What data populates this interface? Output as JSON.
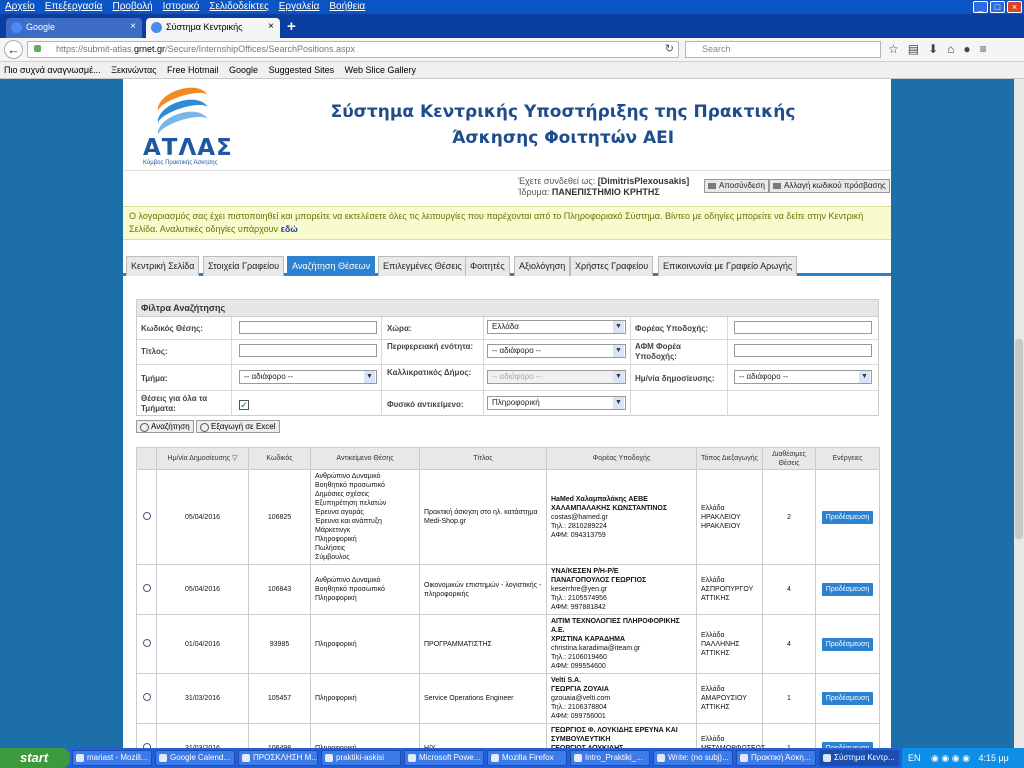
{
  "menu": [
    "Αρχείο",
    "Επεξεργασία",
    "Προβολή",
    "Ιστορικό",
    "Σελιδοδείκτες",
    "Εργαλεία",
    "Βοήθεια"
  ],
  "tabs": [
    {
      "label": "Google",
      "close": "×"
    },
    {
      "label": "Σύστημα Κεντρικής Υποστήριξ...",
      "close": "×"
    }
  ],
  "new_tab": "+",
  "url": {
    "prefix": "https://submit-atlas.",
    "domain": "grnet.gr",
    "path": "/Secure/InternshipOffices/SearchPositions.aspx"
  },
  "search_placeholder": "Search",
  "bookmarks": [
    "Πιο συχνά αναγνωσμέ...",
    "Ξεκινώντας",
    "Free Hotmail",
    "Google",
    "Suggested Sites",
    "Web Slice Gallery"
  ],
  "logo": {
    "text": "ΑΤΛΑΣ",
    "subtitle": "Κόμβος Πρακτικής Άσκησης"
  },
  "site_title": "Σύστημα Κεντρικής Υποστήριξης της Πρακτικής Άσκησης Φοιτητών ΑΕΙ",
  "user": {
    "connected_label": "Έχετε συνδεθεί ως:",
    "username": "[DimitrisPlexousakis]",
    "institution_label": "Ίδρυμα:",
    "institution": "ΠΑΝΕΠΙΣΤΗΜΙΟ ΚΡΗΤΗΣ",
    "logout": "Αποσύνδεση",
    "change_password": "Αλλαγή κωδικού πρόσβασης"
  },
  "notice": {
    "text": "Ο λογαριασμός σας έχει πιστοποιηθεί και μπορείτε να εκτελέσετε όλες τις λειτουργίες που παρέχονται από το Πληροφοριακό Σύστημα. Βίντεο με οδηγίες μπορείτε να δείτε στην Κεντρική Σελίδα. Αναλυτικές οδηγίες υπάρχουν",
    "link": "εδώ"
  },
  "page_tabs": [
    "Κεντρική Σελίδα",
    "Στοιχεία Γραφείου",
    "Αναζήτηση Θέσεων",
    "Επιλεγμένες Θέσεις",
    "Φοιτητές",
    "Αξιολόγηση",
    "Χρήστες Γραφείου",
    "Επικοινωνία με Γραφείο Αρωγής"
  ],
  "filters": {
    "title": "Φίλτρα Αναζήτησης",
    "code": "Κωδικός Θέσης:",
    "country": "Χώρα:",
    "country_value": "Ελλάδα",
    "host": "Φορέας Υποδοχής:",
    "title_label": "Τίτλος:",
    "region": "Περιφερειακή ενότητα:",
    "region_value": "-- αδιάφορο --",
    "host_afm": "ΑΦΜ Φορέα Υποδοχής:",
    "department": "Τμήμα:",
    "department_value": "-- αδιάφορο --",
    "municipality": "Καλλικρατικός Δήμος:",
    "municipality_value": "-- αδιάφορο --",
    "pub_date": "Ημ/νία δημοσίευσης:",
    "pub_date_value": "-- αδιάφορο --",
    "all_departments": "Θέσεις για όλα τα Τμήματα:",
    "all_departments_checked": "✓",
    "physical_object": "Φυσικό αντικείμενο:",
    "physical_object_value": "Πληροφορική"
  },
  "actions": {
    "search": "Αναζήτηση",
    "export": "Εξαγωγή σε Excel"
  },
  "table": {
    "headers": [
      "",
      "Ημ/νία Δημοσίευσης",
      "Κωδικός",
      "Αντικείμενο Θέσης",
      "Τίτλος",
      "Φορέας Υποδοχής",
      "Τόπος Διεξαγωγής",
      "Διαθέσιμες Θέσεις",
      "Ενέργειες"
    ],
    "sort_indicator": "▽",
    "rows": [
      {
        "date": "05/04/2016",
        "code": "106825",
        "objects": [
          "Ανθρώπινο Δυναμικό",
          "Βοηθητικό προσωπικό",
          "Δημόσιες σχέσεις",
          "Εξυπηρέτηση πελατών",
          "Έρευνα αγοράς",
          "Έρευνα και ανάπτυξη",
          "Μάρκετινγκ",
          "Πληροφορική",
          "Πωλήσεις",
          "Σύμβουλος"
        ],
        "title": "Πρακτική άσκηση στο ηλ. κατάστημα Medi-Shop.gr",
        "host": [
          "HaMed Χαλαμπαλάκης ΑΕΒΕ",
          "ΧΑΛΑΜΠΑΛΑΚΗΣ ΚΩΝΣΤΑΝΤΙΝΟΣ"
        ],
        "contact": [
          "costas@hamed.gr",
          "Τηλ.: 2810289224",
          "ΑΦΜ: 094313759"
        ],
        "place": [
          "Ελλάδα",
          "ΗΡΑΚΛΕΙΟΥ",
          "ΗΡΑΚΛΕΙΟΥ"
        ],
        "positions": "2",
        "action": "Προδέσμευση"
      },
      {
        "date": "05/04/2016",
        "code": "106843",
        "objects": [
          "Ανθρώπινο Δυναμικό",
          "Βοηθητικό προσωπικό",
          "Πληροφορική"
        ],
        "title": "Οικονομικών επιστημών - λογιστικής - πληροφορικής",
        "host": [
          "ΥΝΑ/ΚΕΣΕΝ Ρ/Η-Ρ/Ε",
          "ΠΑΝΑΓΟΠΟΥΛΟΣ ΓΕΩΡΓΙΟΣ"
        ],
        "contact": [
          "keserrhre@yen.gr",
          "Τηλ.: 2105574956",
          "ΑΦΜ: 997881842"
        ],
        "place": [
          "Ελλάδα",
          "ΑΣΠΡΟΠΥΡΓΟΥ",
          "ΑΤΤΙΚΗΣ"
        ],
        "positions": "4",
        "action": "Προδέσμευση"
      },
      {
        "date": "01/04/2016",
        "code": "93985",
        "objects": [
          "Πληροφορική"
        ],
        "title": "ΠΡΟΓΡΑΜΜΑΤΙΣΤΗΣ",
        "host": [
          "ΑΙΤΙΜ ΤΕΧΝΟΛΟΓΙΕΣ ΠΛΗΡΟΦΟΡΙΚΗΣ Α.Ε.",
          "ΧΡΙΣΤΙΝΑ ΚΑΡΑΔΗΜΑ"
        ],
        "contact": [
          "christina.karadima@iteam.gr",
          "Τηλ.: 2106019460",
          "ΑΦΜ: 099554600"
        ],
        "place": [
          "Ελλάδα",
          "ΠΑΛΛΗΝΗΣ",
          "ΑΤΤΙΚΗΣ"
        ],
        "positions": "4",
        "action": "Προδέσμευση"
      },
      {
        "date": "31/03/2016",
        "code": "105457",
        "objects": [
          "Πληροφορική"
        ],
        "title": "Service Operations Engineer",
        "host": [
          "Velti S.A.",
          "ΓΕΩΡΓΙΑ ΖΟΥΑΙΑ"
        ],
        "contact": [
          "gzouaia@velti.com",
          "Τηλ.: 2106378804",
          "ΑΦΜ: 099756001"
        ],
        "place": [
          "Ελλάδα",
          "ΑΜΑΡΟΥΣΙΟΥ",
          "ΑΤΤΙΚΗΣ"
        ],
        "positions": "1",
        "action": "Προδέσμευση"
      },
      {
        "date": "31/03/2016",
        "code": "106498",
        "objects": [
          "Πληροφορική"
        ],
        "title": "Η/Υ",
        "host": [
          "ΓΕΩΡΓΙΟΣ Φ. ΛΟΥΚΙΔΗΣ ΕΡΕΥΝΑ ΚΑΙ ΣΥΜΒΟΥΛΕΥΤΙΚΗ",
          "ΓΕΩΡΓΙΟΣ ΛΟΥΚΙΔΗΣ"
        ],
        "contact": [
          "gloukas86@yahoo.gr",
          "Τηλ.: 2103466420"
        ],
        "place": [
          "Ελλάδα",
          "ΜΕΤΑΜΟΡΦΩΣΕΩΣ",
          "ΑΤΤΙΚΗΣ"
        ],
        "positions": "1",
        "action": "Προδέσμευση"
      }
    ]
  },
  "taskbar": {
    "start": "start",
    "items": [
      "mariast - Mozill...",
      "Google Calend...",
      "ΠΡΟΣΚΛΗΣΗ Μ...",
      "praktiki-askisi",
      "Microsoft Powe...",
      "Mozilla Firefox",
      "Intro_Praktiki_...",
      "Write: (no subj)...",
      "Πρακτική Άσκη...",
      "Σύστημα Κεντρ..."
    ],
    "lang": "EN",
    "clock": "4:15 μμ"
  }
}
